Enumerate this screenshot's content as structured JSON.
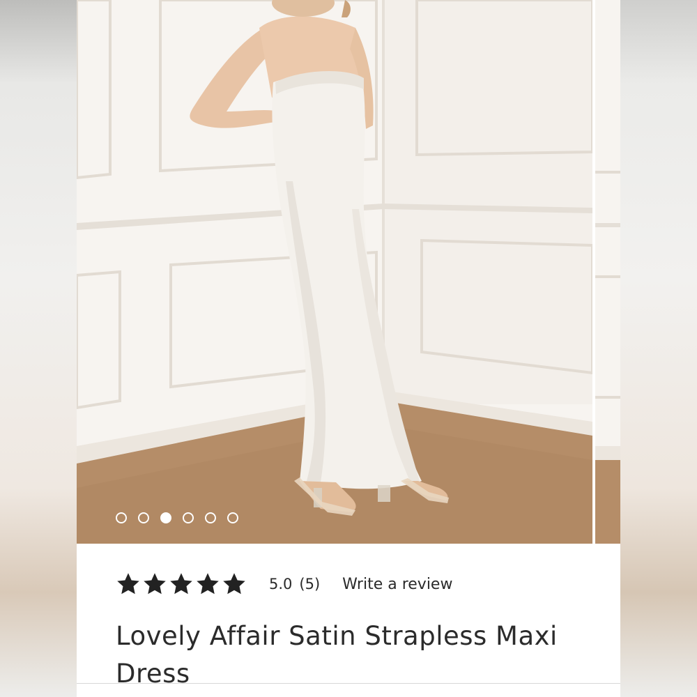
{
  "product": {
    "title": "Lovely Affair Satin Strapless Maxi Dress",
    "image_alt": "White satin strapless maxi dress worn with clear heels"
  },
  "gallery": {
    "total_images": 6,
    "active_index": 3
  },
  "rating": {
    "stars_filled": 5,
    "stars_total": 5,
    "value_label": "5.0",
    "count_label": "(5)",
    "write_review_label": "Write a review"
  },
  "colors": {
    "text": "#2b2b2b",
    "wall": "#f6f3ef",
    "floor": "#b58d68",
    "dress": "#f4f1ec"
  }
}
